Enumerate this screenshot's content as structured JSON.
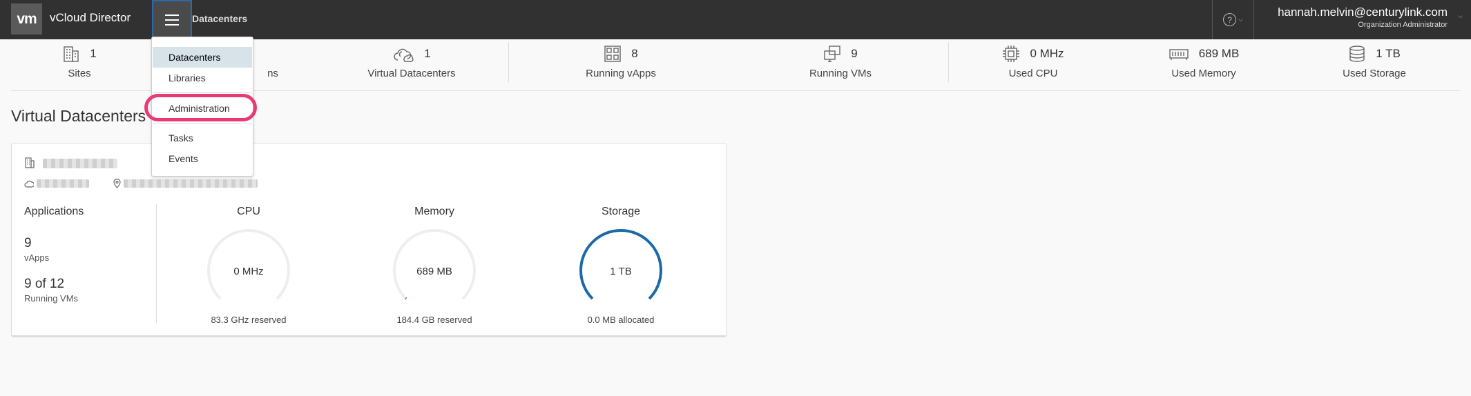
{
  "header": {
    "logo_text": "vm",
    "app_title": "vCloud Director",
    "breadcrumb": "Datacenters",
    "help_icon": "?",
    "user_name": "hannah.melvin@centurylink.com",
    "user_role": "Organization Administrator"
  },
  "summary": {
    "sites": {
      "value": "1",
      "label": "Sites"
    },
    "hidden_stat": {
      "label": "ns"
    },
    "vdcs": {
      "value": "1",
      "label": "Virtual Datacenters"
    },
    "vapps": {
      "value": "8",
      "label": "Running vApps"
    },
    "vms": {
      "value": "9",
      "label": "Running VMs"
    },
    "cpu": {
      "value": "0 MHz",
      "label": "Used CPU"
    },
    "memory": {
      "value": "689 MB",
      "label": "Used Memory"
    },
    "storage": {
      "value": "1 TB",
      "label": "Used Storage"
    }
  },
  "section_title": "Virtual Datacenters",
  "card": {
    "applications_title": "Applications",
    "vapps_count": "9",
    "vapps_label": "vApps",
    "vms_count": "9 of 12",
    "vms_label": "Running VMs",
    "cpu": {
      "title": "CPU",
      "value": "0 MHz",
      "sub": "83.3 GHz reserved",
      "fill": 0.0
    },
    "memory": {
      "title": "Memory",
      "value": "689 MB",
      "sub": "184.4 GB reserved",
      "fill": 0.004
    },
    "storage": {
      "title": "Storage",
      "value": "1 TB",
      "sub": "0.0 MB allocated",
      "fill": 1.0
    }
  },
  "colors": {
    "header_bg": "#313131",
    "gauge_track": "#eeeeee",
    "gauge_fill": "#1b6aa8",
    "highlight": "#ea3a73",
    "menu_active_bg": "#d8e3e9"
  },
  "dropdown": {
    "items": [
      "Datacenters",
      "Libraries",
      "Administration",
      "Tasks",
      "Events"
    ],
    "active": "Datacenters",
    "highlighted": "Administration"
  }
}
